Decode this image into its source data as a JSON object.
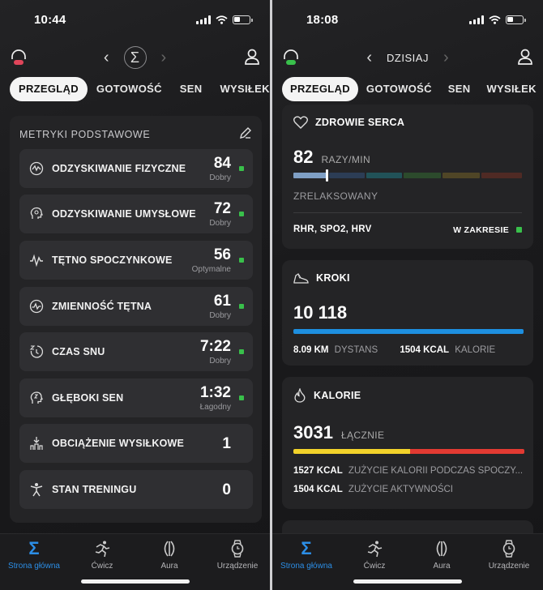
{
  "left": {
    "status_time": "10:44",
    "tabs": [
      "PRZEGLĄD",
      "GOTOWOŚĆ",
      "SEN",
      "WYSIŁEK"
    ],
    "card_title": "METRYKI PODSTAWOWE",
    "metrics": [
      {
        "label": "ODZYSKIWANIE FIZYCZNE",
        "value": "84",
        "status": "Dobry",
        "icon": "physical-recovery-icon",
        "dot": "#39c04b"
      },
      {
        "label": "ODZYSKIWANIE UMYSŁOWE",
        "value": "72",
        "status": "Dobry",
        "icon": "mental-recovery-icon",
        "dot": "#39c04b"
      },
      {
        "label": "TĘTNO SPOCZYNKOWE",
        "value": "56",
        "status": "Optymalne",
        "icon": "pulse-icon",
        "dot": "#39c04b"
      },
      {
        "label": "ZMIENNOŚĆ TĘTNA",
        "value": "61",
        "status": "Dobry",
        "icon": "hrv-icon",
        "dot": "#39c04b"
      },
      {
        "label": "CZAS SNU",
        "value": "7:22",
        "status": "Dobry",
        "icon": "sleep-time-icon",
        "dot": "#39c04b"
      },
      {
        "label": "GŁĘBOKI SEN",
        "value": "1:32",
        "status": "Łagodny",
        "icon": "deep-sleep-icon",
        "dot": "#39c04b"
      },
      {
        "label": "OBCIĄŻENIE WYSIŁKOWE",
        "value": "1",
        "status": "",
        "icon": "training-load-icon",
        "dot": ""
      },
      {
        "label": "STAN TRENINGU",
        "value": "0",
        "status": "",
        "icon": "training-status-icon",
        "dot": ""
      }
    ]
  },
  "right": {
    "status_time": "18:08",
    "date_label": "DZISIAJ",
    "tabs": [
      "PRZEGLĄD",
      "GOTOWOŚĆ",
      "SEN",
      "WYSIŁEK"
    ],
    "heart": {
      "title": "ZDROWIE SERCA",
      "value": "82",
      "unit": "RAZY/MIN",
      "state": "ZRELAKSOWANY",
      "metrics_label": "RHR, SPO2, HRV",
      "range_label": "W ZAKRESIE"
    },
    "steps": {
      "title": "KROKI",
      "value": "10 118",
      "distance_value": "8.09 KM",
      "distance_label": "DYSTANS",
      "calories_value": "1504 KCAL",
      "calories_label": "KALORIE"
    },
    "calories": {
      "title": "KALORIE",
      "value": "3031",
      "unit": "ŁĄCZNIE",
      "resting_value": "1527 KCAL",
      "resting_label": "ZUŻYCIE KALORII PODCZAS SPOCZY...",
      "active_value": "1504 KCAL",
      "active_label": "ZUŻYCIE AKTYWNOŚCI"
    }
  },
  "bottom_nav": [
    "Strona główna",
    "Ćwicz",
    "Aura",
    "Urządzenie"
  ],
  "colors": {
    "accent": "#2c8ee6",
    "good": "#39c04b",
    "yellow": "#f2d22a",
    "red": "#e23a32"
  }
}
